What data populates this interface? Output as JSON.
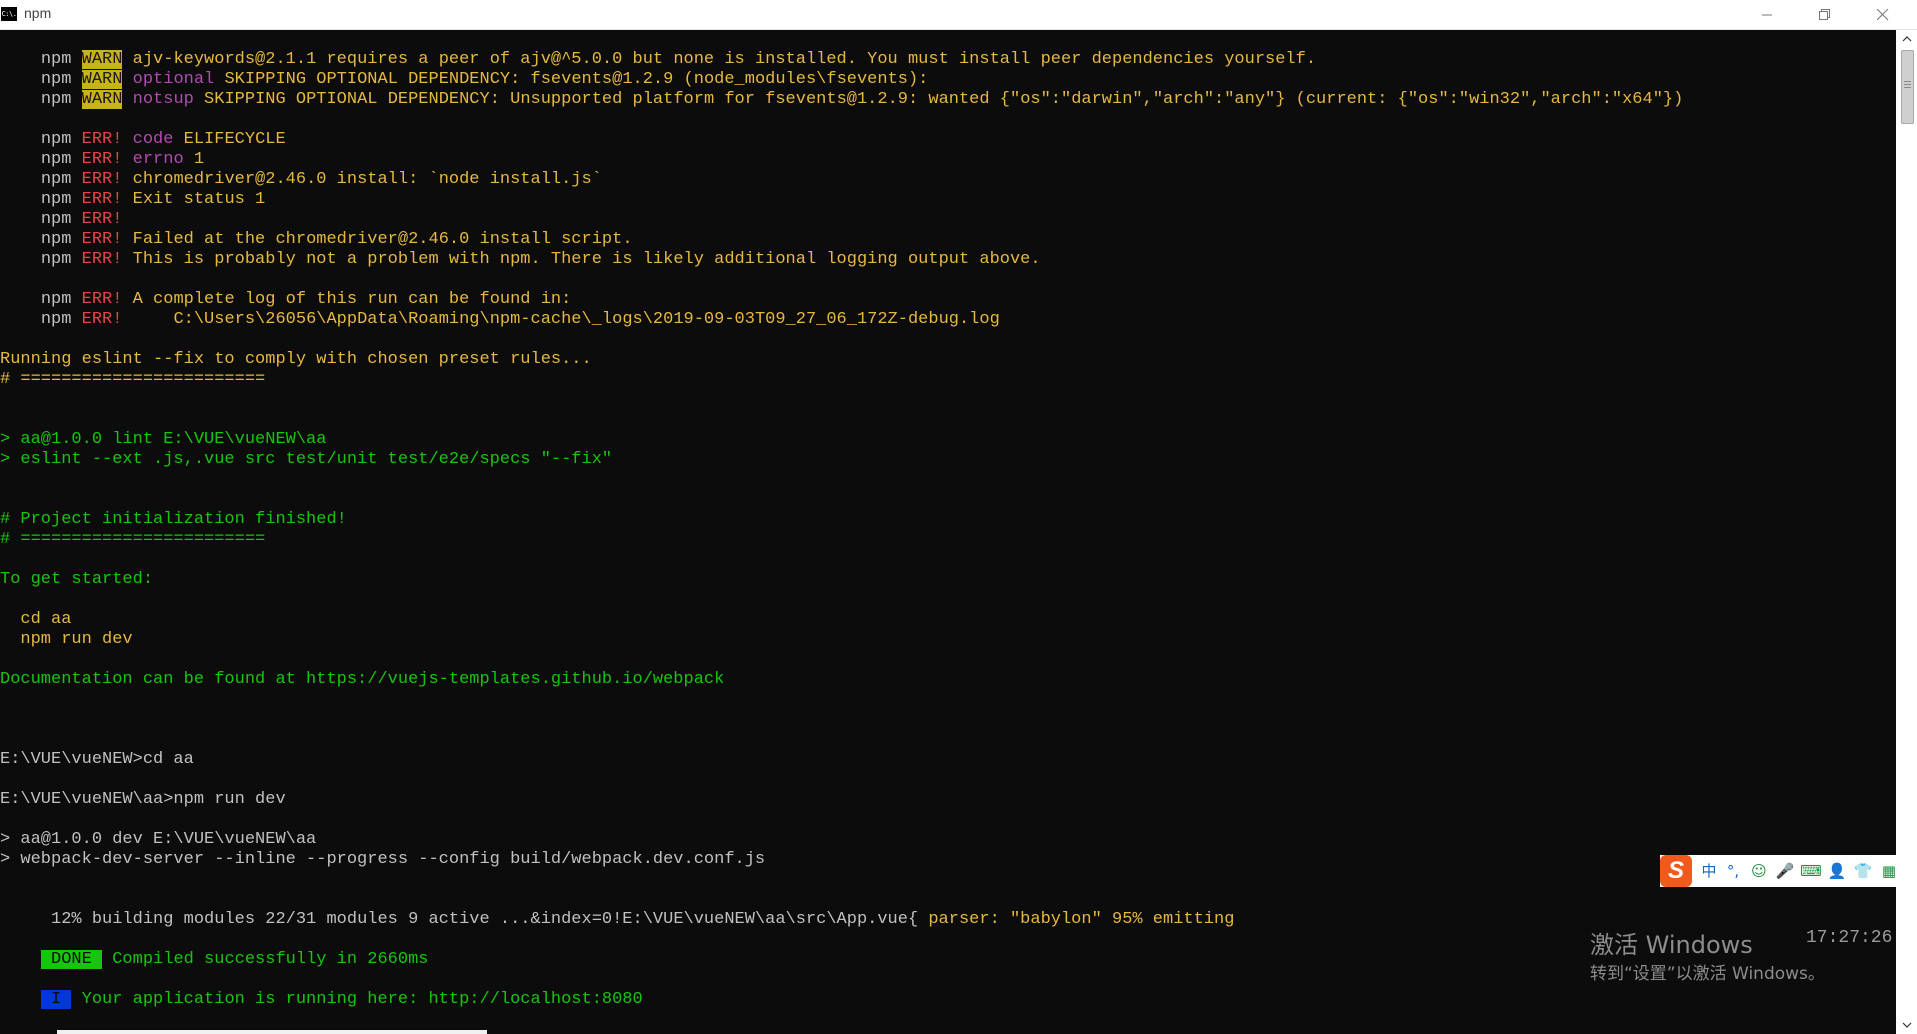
{
  "window": {
    "title": "npm",
    "icon_text": "C:\\."
  },
  "console": {
    "warn_lines": [
      {
        "prefix": "npm ",
        "tag": "WARN",
        "text": " ajv-keywords@2.1.1 requires a peer of ajv@^5.0.0 but none is installed. You must install peer dependencies yourself."
      },
      {
        "prefix": "npm ",
        "tag": "WARN",
        "kind": " optional",
        "text": " SKIPPING OPTIONAL DEPENDENCY: fsevents@1.2.9 (node_modules\\fsevents):"
      },
      {
        "prefix": "npm ",
        "tag": "WARN",
        "kind": " notsup",
        "text": " SKIPPING OPTIONAL DEPENDENCY: Unsupported platform for fsevents@1.2.9: wanted {\"os\":\"darwin\",\"arch\":\"any\"} (current: {\"os\":\"win32\",\"arch\":\"x64\"})"
      }
    ],
    "err_lines": [
      {
        "prefix": "npm ",
        "tag": "ERR!",
        "kind": " code",
        "text": " ELIFECYCLE"
      },
      {
        "prefix": "npm ",
        "tag": "ERR!",
        "kind": " errno",
        "text": " 1"
      },
      {
        "prefix": "npm ",
        "tag": "ERR!",
        "text": " chromedriver@2.46.0 install: `node install.js`"
      },
      {
        "prefix": "npm ",
        "tag": "ERR!",
        "text": " Exit status 1"
      },
      {
        "prefix": "npm ",
        "tag": "ERR!",
        "text": ""
      },
      {
        "prefix": "npm ",
        "tag": "ERR!",
        "text": " Failed at the chromedriver@2.46.0 install script."
      },
      {
        "prefix": "npm ",
        "tag": "ERR!",
        "text": " This is probably not a problem with npm. There is likely additional logging output above."
      },
      {
        "prefix": "npm ",
        "tag": "ERR!",
        "text": " A complete log of this run can be found in:"
      },
      {
        "prefix": "npm ",
        "tag": "ERR!",
        "text": "     C:\\Users\\26056\\AppData\\Roaming\\npm-cache\\_logs\\2019-09-03T09_27_06_172Z-debug.log"
      }
    ],
    "eslint_running": "Running eslint --fix to comply with chosen preset rules...",
    "separator1": "# ========================",
    "lint_cmd1": "> aa@1.0.0 lint E:\\VUE\\vueNEW\\aa",
    "lint_cmd2": "> eslint --ext .js,.vue src test/unit test/e2e/specs \"--fix\"",
    "project_finished": "# Project initialization finished!",
    "separator2": "# ========================",
    "get_started": "To get started:",
    "cd_cmd": "  cd aa",
    "run_cmd": "  npm run dev",
    "docs": "Documentation can be found at https://vuejs-templates.github.io/webpack",
    "prompt1": "E:\\VUE\\vueNEW>cd aa",
    "prompt2": "E:\\VUE\\vueNEW\\aa>npm run dev",
    "dev_cmd1": "> aa@1.0.0 dev E:\\VUE\\vueNEW\\aa",
    "dev_cmd2": "> webpack-dev-server --inline --progress --config build/webpack.dev.conf.js",
    "building_part1": " 12% building modules 22/31 modules 9 active ...&index=0!E:\\VUE\\vueNEW\\aa\\src\\App.vue{ ",
    "building_part2": "parser: \"babylon\" 95% emitting",
    "done_tag": " DONE ",
    "done_text": " Compiled successfully in 2660ms",
    "info_tag": " I ",
    "info_text": " Your application is running here: http://localhost:8080"
  },
  "ime": {
    "logo": "S",
    "items": [
      "中",
      "°,",
      "☺",
      "🎤",
      "⌨",
      "👤",
      "👕",
      "▦"
    ]
  },
  "activation": {
    "title": "激活 Windows",
    "subtitle": "转到“设置”以激活 Windows。",
    "time": "17:27:26"
  },
  "colors": {
    "background": "#0c0c0c",
    "warn_bg": "#c7b41a",
    "err": "#e8434a",
    "done_bg": "#16c60c",
    "info_bg": "#0037da",
    "green_text": "#16c60c",
    "yellow_text": "#e5b83f"
  }
}
